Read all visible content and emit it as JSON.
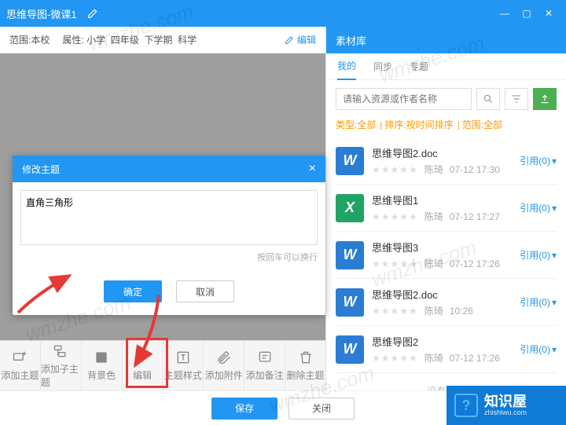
{
  "title": "思维导图-微课1",
  "meta": {
    "scope_l": "范围:",
    "scope_v": "本校",
    "attr_l": "属性:",
    "a1": "小学",
    "a2": "四年级",
    "a3": "下学期",
    "a4": "科学",
    "edit": "编辑"
  },
  "dialog": {
    "title": "修改主题",
    "value": "直角三角形",
    "hint": "按回车可以换行",
    "ok": "确定",
    "cancel": "取消"
  },
  "toolbar": [
    {
      "k": "add-topic",
      "t": "添加主题"
    },
    {
      "k": "add-subtopic",
      "t": "添加子主题"
    },
    {
      "k": "bg-color",
      "t": "背景色"
    },
    {
      "k": "edit",
      "t": "编辑"
    },
    {
      "k": "topic-style",
      "t": "主题样式"
    },
    {
      "k": "add-attach",
      "t": "添加附件"
    },
    {
      "k": "add-note",
      "t": "添加备注"
    },
    {
      "k": "delete-topic",
      "t": "删除主题"
    }
  ],
  "right": {
    "title": "素材库",
    "tabs": [
      "我的",
      "同步",
      "专题"
    ],
    "placeholder": "请输入资源或作者名称",
    "filters": [
      "类型:全部",
      "排序:按时间排序",
      "范围:全部"
    ],
    "items": [
      {
        "ic": "w",
        "name": "思维导图2.doc",
        "author": "陈琦",
        "time": "07-12 17:30",
        "cite": "引用(0)"
      },
      {
        "ic": "x",
        "name": "思维导图1",
        "author": "陈琦",
        "time": "07-12 17:27",
        "cite": "引用(0)"
      },
      {
        "ic": "w",
        "name": "思维导图3",
        "author": "陈琦",
        "time": "07-12 17:26",
        "cite": "引用(0)"
      },
      {
        "ic": "w",
        "name": "思维导图2.doc",
        "author": "陈琦",
        "time": "10:26",
        "cite": "引用(0)"
      },
      {
        "ic": "w",
        "name": "思维导图2",
        "author": "陈琦",
        "time": "07-12 17:26",
        "cite": "引用(0)"
      }
    ],
    "nomore": "没有更多"
  },
  "footer": {
    "save": "保存",
    "close": "关闭"
  },
  "brand": {
    "name": "知识屋",
    "sub": "zhishiwu.com"
  },
  "wm": "wmzhe.com"
}
